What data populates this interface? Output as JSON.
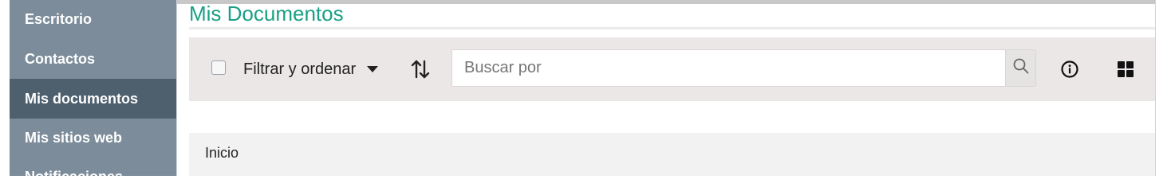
{
  "sidebar": {
    "items": [
      {
        "label": "Escritorio"
      },
      {
        "label": "Contactos"
      },
      {
        "label": "Mis documentos",
        "active": true
      },
      {
        "label": "Mis sitios web"
      },
      {
        "label": "Notificaciones"
      }
    ]
  },
  "main": {
    "title": "Mis Documentos"
  },
  "toolbar": {
    "filter_label": "Filtrar y ordenar",
    "sort_icon": "sort-arrows-icon",
    "search": {
      "placeholder": "Buscar por",
      "value": "",
      "icon": "search-icon"
    },
    "info_icon": "info-icon",
    "view_icon": "grid-view-icon"
  },
  "breadcrumb": {
    "home_label": "Inicio"
  },
  "colors": {
    "sidebar_bg": "#7c8c9a",
    "sidebar_active_bg": "#4e5f6e",
    "title_accent": "#1aa085",
    "toolbar_bg": "#ebe7e6"
  }
}
